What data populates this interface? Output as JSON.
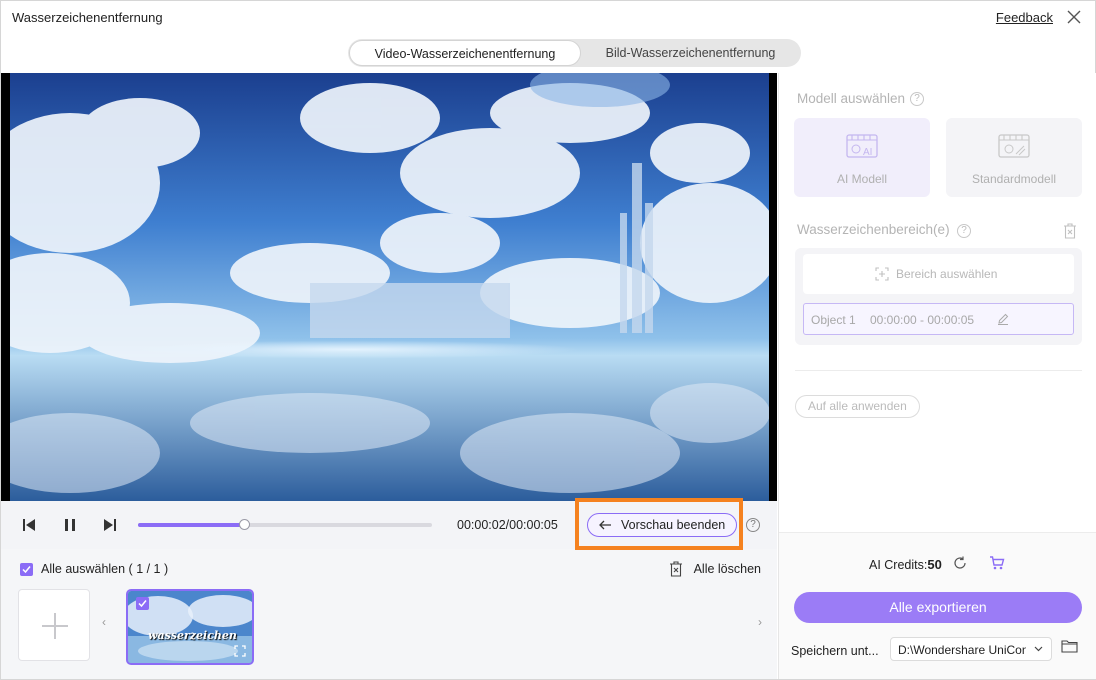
{
  "window": {
    "title": "Wasserzeichenentfernung",
    "feedback": "Feedback"
  },
  "mode_tabs": [
    {
      "label": "Video-Wasserzeichenentfernung",
      "active": true
    },
    {
      "label": "Bild-Wasserzeichenentfernung",
      "active": false
    }
  ],
  "player": {
    "timecode": "00:00:02/00:00:05",
    "progress_fraction": 0.36,
    "preview_button": "Vorschau beenden"
  },
  "file_list": {
    "select_all": "Alle auswählen ( 1 / 1 )",
    "clear_all": "Alle löschen",
    "thumbnail_watermark_text": "wasserzeichen"
  },
  "right_panel": {
    "model_heading": "Modell auswählen",
    "models": [
      {
        "label": "AI Modell",
        "icon": "ai-model-icon"
      },
      {
        "label": "Standardmodell",
        "icon": "standard-model-icon"
      }
    ],
    "region_heading": "Wasserzeichenbereich(e)",
    "select_area": "Bereich auswählen",
    "object": {
      "name": "Object 1",
      "range": "00:00:00 - 00:00:05"
    },
    "apply_all": "Auf alle anwenden",
    "credits_label": "AI Credits:",
    "credits_value": "50",
    "export_button": "Alle exportieren",
    "save_label": "Speichern unt...",
    "save_path": "D:\\Wondershare UniConverter"
  },
  "colors": {
    "accent": "#8b6cf6",
    "highlight": "#f5821f"
  }
}
